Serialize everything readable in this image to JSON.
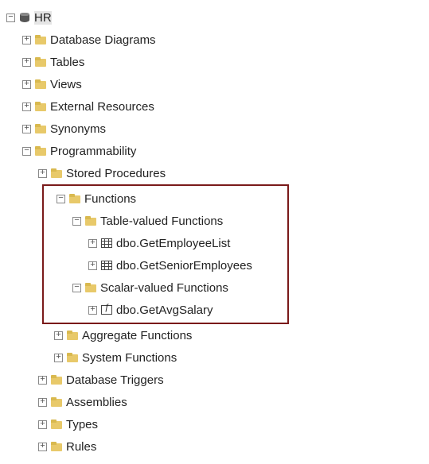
{
  "db": {
    "name": "HR"
  },
  "folders": {
    "diagrams": "Database Diagrams",
    "tables": "Tables",
    "views": "Views",
    "extres": "External Resources",
    "synonyms": "Synonyms",
    "programmability": "Programmability",
    "storedprocs": "Stored Procedures",
    "functions": "Functions",
    "tvf": "Table-valued Functions",
    "svf": "Scalar-valued Functions",
    "aggfn": "Aggregate Functions",
    "sysfn": "System Functions",
    "dbtriggers": "Database Triggers",
    "assemblies": "Assemblies",
    "types": "Types",
    "rules": "Rules"
  },
  "fns": {
    "getEmployeeList": "dbo.GetEmployeeList",
    "getSeniorEmployees": "dbo.GetSeniorEmployees",
    "getAvgSalary": "dbo.GetAvgSalary"
  },
  "glyph": {
    "plus": "+",
    "minus": "−"
  }
}
